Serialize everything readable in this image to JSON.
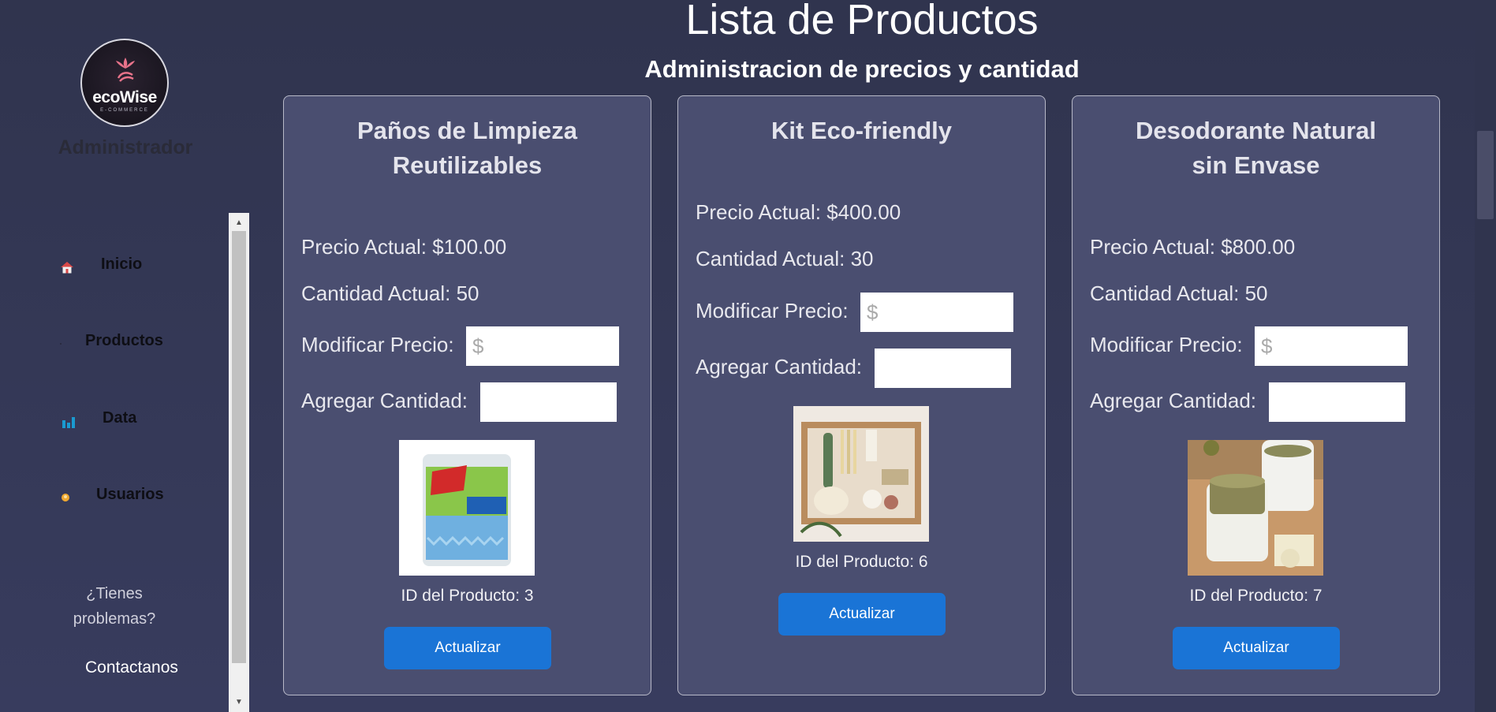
{
  "sidebar": {
    "logo_text": "ecoWise",
    "logo_sub": "E-COMMERCE",
    "role_title": "Administrador",
    "nav": [
      {
        "label": "Inicio",
        "icon": "home-icon"
      },
      {
        "label": "Productos",
        "icon": "box-icon"
      },
      {
        "label": "Data",
        "icon": "bar-chart-icon"
      },
      {
        "label": "Usuarios",
        "icon": "user-icon"
      }
    ],
    "help_text": "¿Tienes problemas?",
    "contact_label": "Contactanos"
  },
  "main": {
    "title": "Lista de Productos",
    "subtitle": "Administracion de precios y cantidad"
  },
  "products": [
    {
      "name": "Paños de Limpieza Reutilizables",
      "price_text": "Precio Actual: $100.00",
      "qty_text": "Cantidad Actual: 50",
      "modify_label": "Modificar Precio:",
      "price_placeholder": "$",
      "add_label": "Agregar Cantidad:",
      "id_text": "ID del Producto: 3",
      "button_label": "Actualizar"
    },
    {
      "name": "Kit Eco-friendly",
      "price_text": "Precio Actual: $400.00",
      "qty_text": "Cantidad Actual: 30",
      "modify_label": "Modificar Precio:",
      "price_placeholder": "$",
      "add_label": "Agregar Cantidad:",
      "id_text": "ID del Producto: 6",
      "button_label": "Actualizar"
    },
    {
      "name": "Desodorante Natural sin Envase",
      "price_text": "Precio Actual: $800.00",
      "qty_text": "Cantidad Actual: 50",
      "modify_label": "Modificar Precio:",
      "price_placeholder": "$",
      "add_label": "Agregar Cantidad:",
      "id_text": "ID del Producto: 7",
      "button_label": "Actualizar"
    }
  ],
  "colors": {
    "accent_button": "#1a74d6",
    "card_bg": "#4a4e70",
    "page_bg": "#30344e"
  }
}
